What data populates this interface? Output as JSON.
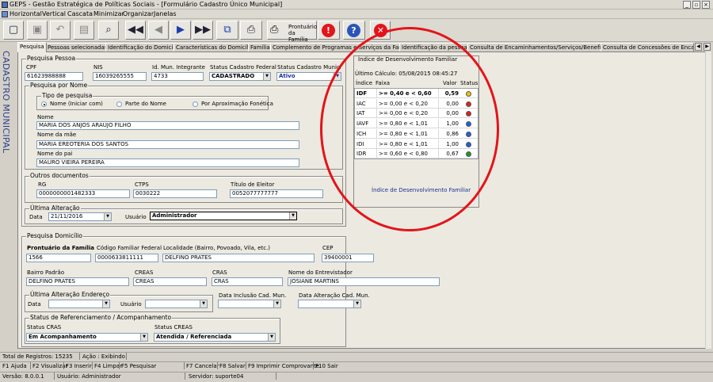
{
  "window": {
    "title": "GEPS - Gestão Estratégica de Políticas Sociais - [Formulário Cadastro Único Municipal]",
    "controls": {
      "minimize": "_",
      "restore": "▫",
      "close": "×"
    }
  },
  "menu": [
    "Horizontal",
    "Vertical",
    "Cascata",
    "Minimizar",
    "Organizar",
    "Janelas"
  ],
  "toolbar": {
    "familia_label_line1": "Prontuário",
    "familia_label_line2": "da Família"
  },
  "tabs": [
    "Pesquisa",
    "Pessoas selecionadas",
    "Identificação do Domicílio",
    "Características do Domicílio",
    "Família",
    "Complemento de Programas e Serviços da Família",
    "Identificação da pessoa",
    "Consulta de Encaminhamentos/Serviços/Benefícios",
    "Consulta de Concessões de Encaminha"
  ],
  "side_label": "CADASTRO MUNICIPAL",
  "pesquisa_pessoa": {
    "title": "Pesquisa Pessoa",
    "cpf_label": "CPF",
    "cpf": "61623988888",
    "nis_label": "NIS",
    "nis": "16039265555",
    "id_mun_label": "Id. Mun. Integrante",
    "id_mun": "4733",
    "status_federal_label": "Status Cadastro Federal",
    "status_federal": "CADASTRADO",
    "status_municipal_label": "Status Cadastro Municip",
    "status_municipal": "Ativo",
    "por_nome_title": "Pesquisa por Nome",
    "tipo_title": "Tipo de pesquisa",
    "radio_iniciar": "Nome (Iniciar com)",
    "radio_parte": "Parte do Nome",
    "radio_fonetica": "Por Aproximação Fonética",
    "nome_label": "Nome",
    "nome": "MARIA DOS ANJOS ARAUJO FILHO",
    "mae_label": "Nome da mãe",
    "mae": "MARIA EREOTERIA DOS SANTOS",
    "pai_label": "Nome do pai",
    "pai": "MAURO VIEIRA PEREIRA",
    "outros_title": "Outros documentos",
    "rg_label": "RG",
    "rg": "0000000001482333",
    "ctps_label": "CTPS",
    "ctps": "0030222",
    "titulo_label": "Título de Eleitor",
    "titulo": "0052077777777",
    "alteracao_title": "Última Alteração",
    "data_label": "Data",
    "data": "21/11/2016",
    "usuario_label": "Usuário",
    "usuario": "Administrador"
  },
  "idf": {
    "title": "Índice de Desenvolvimento Familiar",
    "ultimo_calculo": "Último Cálculo: 05/08/2015 08:45:27",
    "headers": [
      "Índice",
      "Faixa",
      "Valor",
      "Status"
    ],
    "rows": [
      {
        "indice": "IDF",
        "faixa": ">= 0,40 e < 0,60",
        "valor": "0,59",
        "color": "#f2c400",
        "bold": true
      },
      {
        "indice": "IAC",
        "faixa": ">= 0,00 e < 0,20",
        "valor": "0,00",
        "color": "#e0201a",
        "bold": false
      },
      {
        "indice": "IAT",
        "faixa": ">= 0,00 e < 0,20",
        "valor": "0,00",
        "color": "#e0201a",
        "bold": false
      },
      {
        "indice": "IAVF",
        "faixa": ">= 0,80 e < 1,01",
        "valor": "1,00",
        "color": "#1f5fe0",
        "bold": false
      },
      {
        "indice": "ICH",
        "faixa": ">= 0,80 e < 1,01",
        "valor": "0,86",
        "color": "#1f5fe0",
        "bold": false
      },
      {
        "indice": "IDI",
        "faixa": ">= 0,80 e < 1,01",
        "valor": "1,00",
        "color": "#1f5fe0",
        "bold": false
      },
      {
        "indice": "IDR",
        "faixa": ">= 0,60 e < 0,80",
        "valor": "0,67",
        "color": "#1a9a2a",
        "bold": false
      }
    ],
    "footer": "Índice de Desenvolvimento Familiar"
  },
  "pesquisa_domicilio": {
    "title": "Pesquisa Domicílio",
    "prontuario_label": "Prontuário da Família",
    "prontuario": "1566",
    "codigo_label": "Código Familiar Federal",
    "codigo": "0000633811111",
    "localidade_label": "Localidade (Bairro, Povoado, Vila, etc.)",
    "localidade": "DELFINO PRATES",
    "cep_label": "CEP",
    "cep": "39400001",
    "bairro_label": "Bairro Padrão",
    "bairro": "DELFINO PRATES",
    "creas1_label": "CREAS",
    "creas1": "CREAS",
    "cras_label": "CRAS",
    "cras": "CRAS",
    "entrevistador_label": "Nome do Entrevistador",
    "entrevistador": "JOSIANE MARTINS",
    "ult_end_title": "Última Alteração Endereço",
    "data_label": "Data",
    "usuario_label": "Usuário",
    "inclusao_label": "Data Inclusão Cad. Mun.",
    "alteracao_label": "Data Alteração Cad. Mun.",
    "status_title": "Status de Referenciamento / Acompanhamento",
    "status_cras_label": "Status CRAS",
    "status_cras": "Em Acompanhamento",
    "status_creas_label": "Status CREAS",
    "status_creas": "Atendida / Referenciada"
  },
  "status": {
    "total_label": "Total de Registros: 15235",
    "acao": "Ação : Exibindo",
    "shortcuts": [
      "F1 Ajuda",
      "F2 Visualizar",
      "F3 Inserir",
      "F4 Limpar",
      "F5 Pesquisar",
      "F7 Cancelar",
      "F8 Salvar",
      "F9 Imprimir Comprovante",
      "F10 Sair"
    ],
    "versao": "Versão: 8.0.0.1",
    "usuario": "Usuário: Administrador",
    "servidor": "Servidor: suporte04"
  },
  "annotation_color": "#e3141a"
}
